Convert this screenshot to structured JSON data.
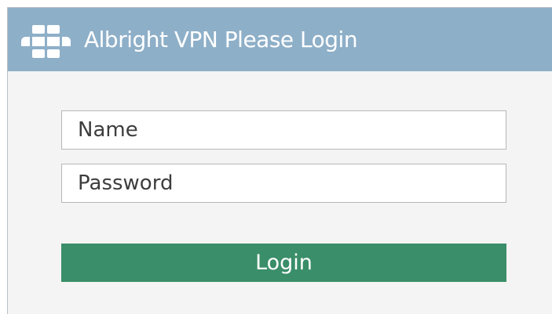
{
  "header": {
    "icon": "fortinet-logo-icon",
    "title": "Albright VPN Please Login"
  },
  "form": {
    "name_placeholder": "Name",
    "password_placeholder": "Password",
    "login_label": "Login"
  },
  "colors": {
    "header_background": "#8eafc8",
    "button_background": "#3a8e69",
    "panel_background": "#f4f4f4"
  }
}
